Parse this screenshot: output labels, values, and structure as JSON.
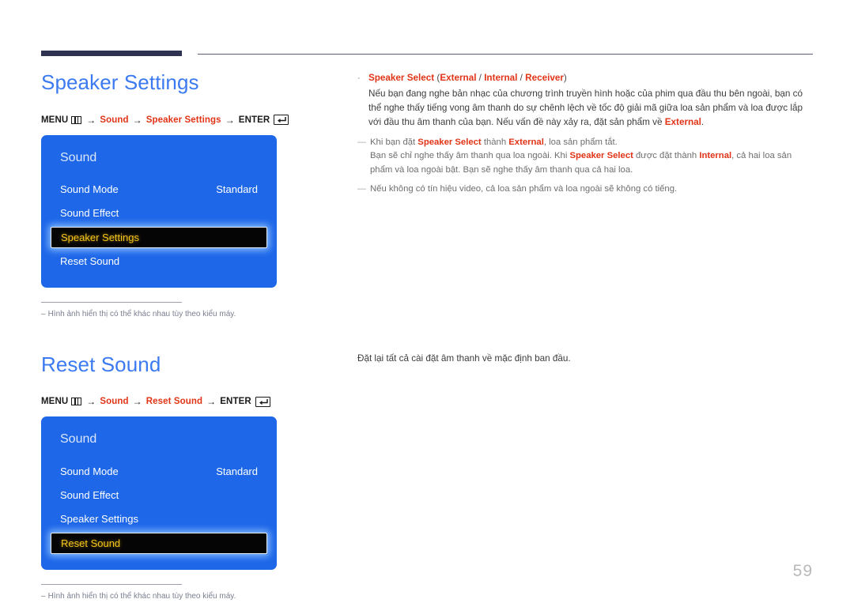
{
  "page": {
    "number": "59"
  },
  "icons": {
    "menu": "menu-bars-icon",
    "enter": "enter-return-icon",
    "bullet": "·",
    "arrow": "→",
    "dash": "—",
    "footnote_dash": "–"
  },
  "colors": {
    "heading": "#3b7af0",
    "accent_red": "#e23417",
    "osd_blue": "#1d67e8",
    "osd_selected_bg": "#050505",
    "osd_selected_text": "#f5c518",
    "rule_dark": "#2f3351"
  },
  "sections": [
    {
      "title": "Speaker Settings",
      "menu_path": {
        "menu_label": "MENU",
        "arrow": "→",
        "step1": "Sound",
        "step2": "Speaker Settings",
        "enter_label": "ENTER"
      },
      "osd": {
        "title": "Sound",
        "rows": [
          {
            "label": "Sound Mode",
            "value": "Standard",
            "selected": false
          },
          {
            "label": "Sound Effect",
            "value": "",
            "selected": false
          },
          {
            "label": "Speaker Settings",
            "value": "",
            "selected": true
          },
          {
            "label": "Reset Sound",
            "value": "",
            "selected": false
          }
        ]
      },
      "footnote": "Hình ảnh hiển thị có thể khác nhau tùy theo kiểu máy."
    },
    {
      "title": "Reset Sound",
      "menu_path": {
        "menu_label": "MENU",
        "arrow": "→",
        "step1": "Sound",
        "step2": "Reset Sound",
        "enter_label": "ENTER"
      },
      "osd": {
        "title": "Sound",
        "rows": [
          {
            "label": "Sound Mode",
            "value": "Standard",
            "selected": false
          },
          {
            "label": "Sound Effect",
            "value": "",
            "selected": false
          },
          {
            "label": "Speaker Settings",
            "value": "",
            "selected": false
          },
          {
            "label": "Reset Sound",
            "value": "",
            "selected": true
          }
        ]
      },
      "footnote": "Hình ảnh hiển thị có thể khác nhau tùy theo kiểu máy."
    }
  ],
  "right": {
    "bullet": {
      "term": "Speaker Select",
      "open_paren": " (",
      "option1": "External",
      "sep1": " / ",
      "option2": "Internal",
      "sep2": " / ",
      "option3": "Receiver",
      "close_paren": ")",
      "paragraph_1": "Nếu bạn đang nghe bản nhạc của chương trình truyền hình hoặc của phim qua đầu thu bên ngoài, bạn có thể nghe thấy tiếng vong âm thanh do sự chênh lệch về tốc độ giải mã giữa loa sản phẩm và loa được lắp với đầu thu âm thanh của bạn. Nếu vấn đề này xảy ra, đặt sản phẩm về ",
      "paragraph_1_red": "External",
      "paragraph_1_end": "."
    },
    "notes": [
      {
        "line1_a": "Khi bạn đặt ",
        "line1_red1": "Speaker Select",
        "line1_b": " thành ",
        "line1_red2": "External",
        "line1_c": ", loa sản phẩm tắt.",
        "line2_a": "Bạn sẽ chỉ nghe thấy âm thanh qua loa ngoài. Khi ",
        "line2_red1": "Speaker Select",
        "line2_b": " được đặt thành ",
        "line2_red2": "Internal",
        "line2_c": ", cả hai loa sản phẩm và loa ngoài bật. Bạn sẽ nghe thấy âm thanh qua cả hai loa."
      },
      {
        "line1_a": "Nếu không có tín hiệu video, cả loa sản phẩm và loa ngoài sẽ không có tiếng."
      }
    ],
    "reset_description": "Đặt lại tất cả cài đặt âm thanh về mặc định ban đầu."
  }
}
